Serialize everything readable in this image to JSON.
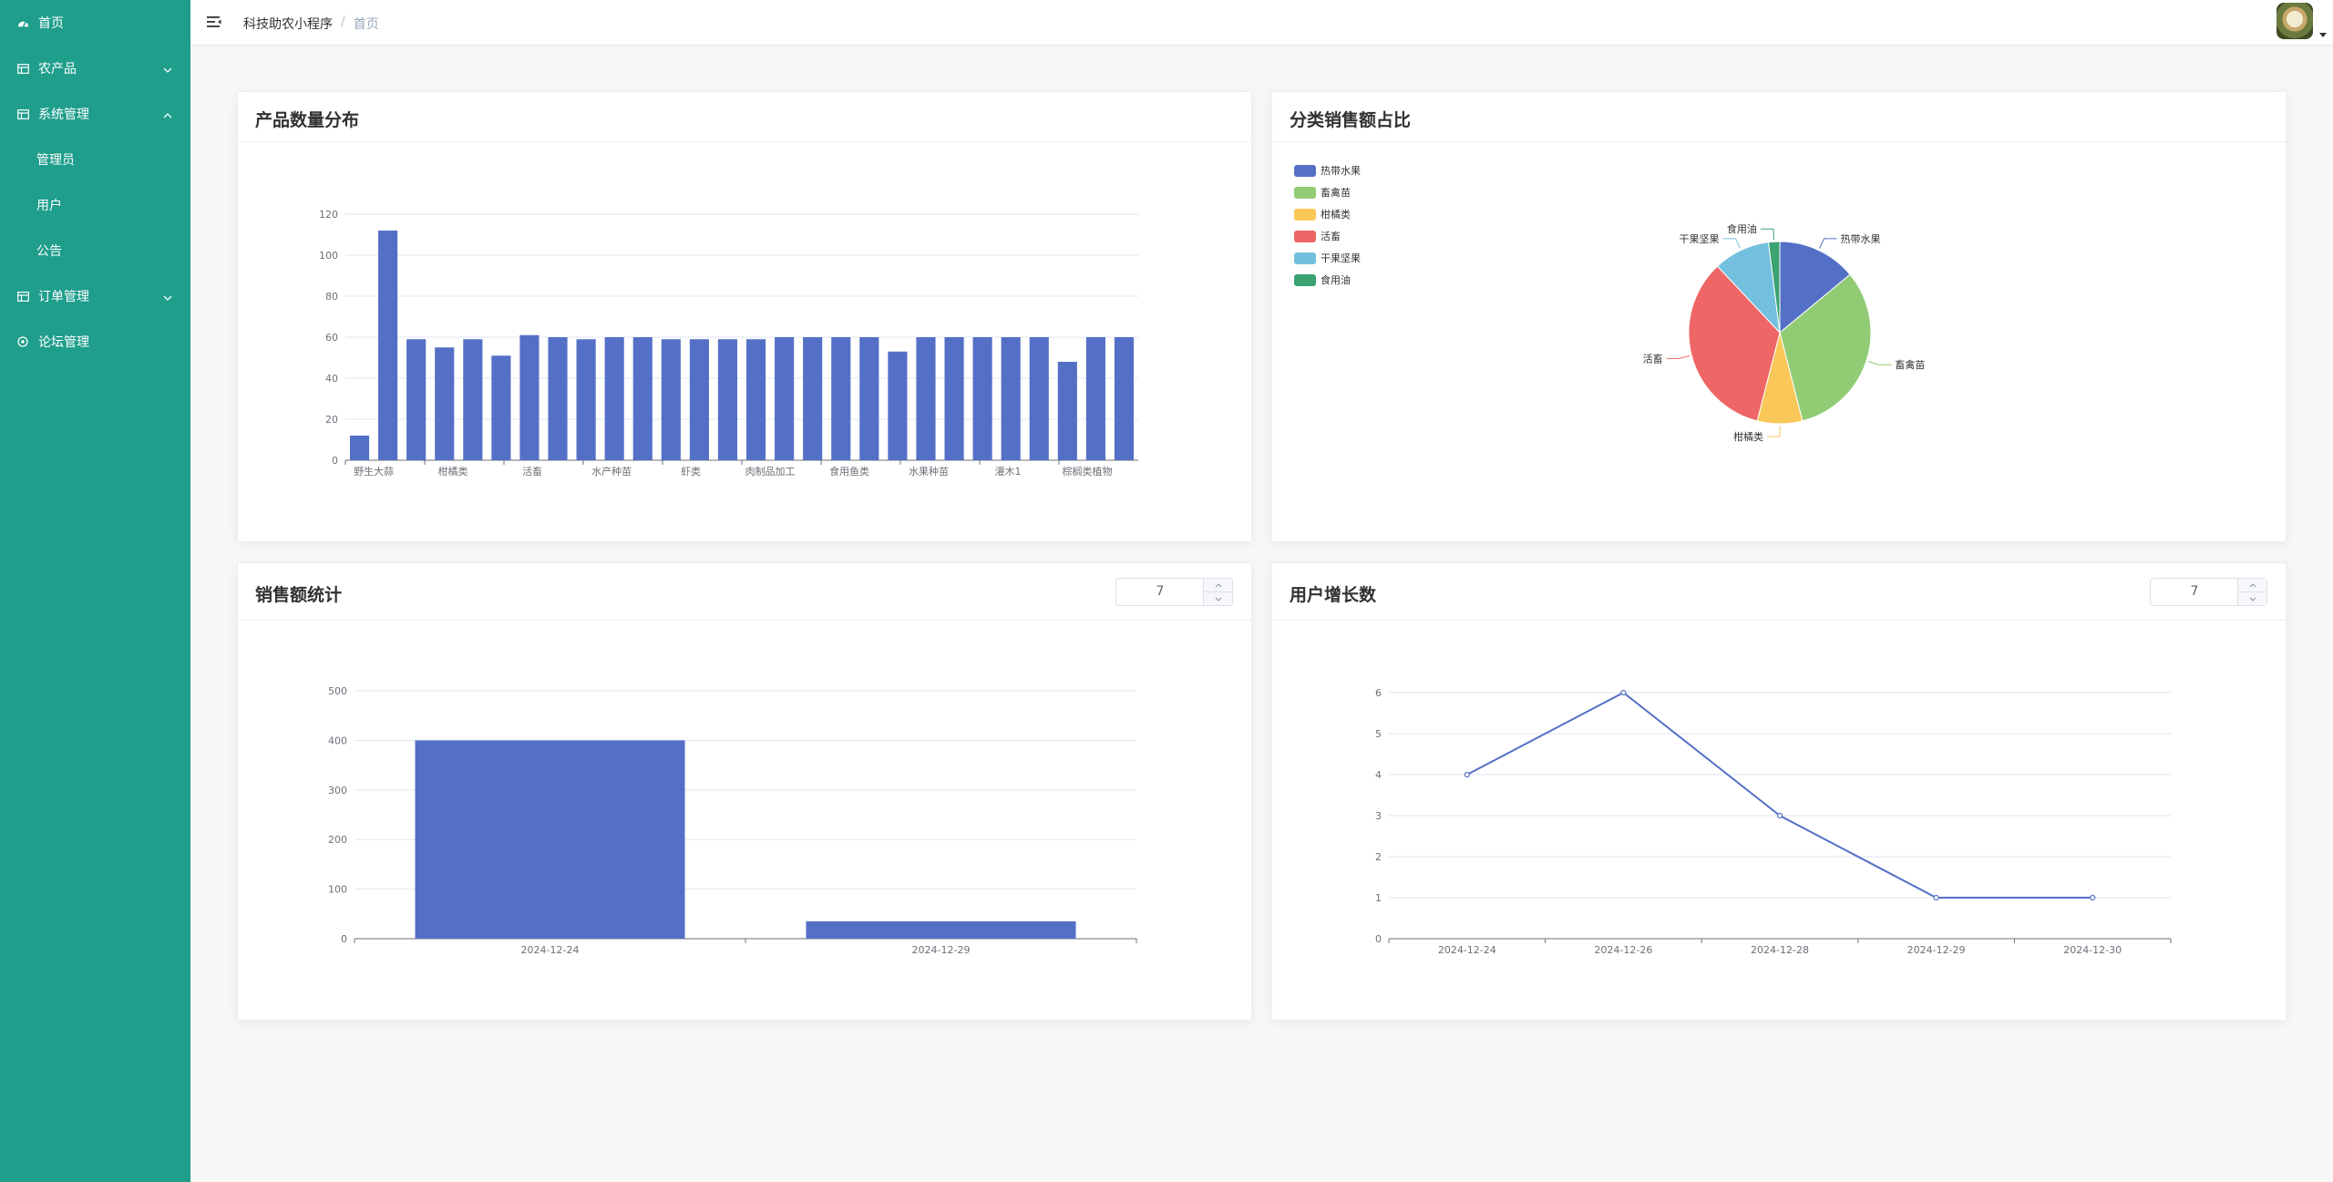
{
  "sidebar": {
    "items": [
      {
        "label": "首页",
        "icon": "dashboard-icon"
      },
      {
        "label": "农产品",
        "icon": "table-icon",
        "expanded": false
      },
      {
        "label": "系统管理",
        "icon": "table-icon",
        "expanded": true,
        "children": [
          {
            "label": "管理员"
          },
          {
            "label": "用户"
          },
          {
            "label": "公告"
          }
        ]
      },
      {
        "label": "订单管理",
        "icon": "table-icon",
        "expanded": false
      },
      {
        "label": "论坛管理",
        "icon": "forum-icon"
      }
    ],
    "bg_color": "#1f9e8c"
  },
  "header": {
    "breadcrumb": [
      "科技助农小程序",
      "首页"
    ]
  },
  "cards": {
    "product_count": {
      "title": "产品数量分布"
    },
    "category_sales": {
      "title": "分类销售额占比"
    },
    "sales_stats": {
      "title": "销售额统计",
      "days_value": "7"
    },
    "user_growth": {
      "title": "用户增长数",
      "days_value": "7"
    }
  },
  "chart_data": [
    {
      "type": "bar",
      "id": "product_count",
      "color": "#5470c6",
      "ylim": [
        0,
        120
      ],
      "yticks": [
        0,
        20,
        40,
        60,
        80,
        100,
        120
      ],
      "x_tick_labels": [
        "野生大蒜",
        "柑橘类",
        "活畜",
        "水产种苗",
        "虾类",
        "肉制品加工",
        "食用鱼类",
        "水果种苗",
        "灌木1",
        "棕榈类植物"
      ],
      "values": [
        12,
        112,
        59,
        55,
        59,
        51,
        61,
        60,
        59,
        60,
        60,
        59,
        59,
        59,
        59,
        60,
        60,
        60,
        60,
        53,
        60,
        60,
        60,
        60,
        60,
        48,
        60,
        60
      ]
    },
    {
      "type": "pie",
      "id": "category_sales",
      "slices": [
        {
          "name": "热带水果",
          "value": 14,
          "color": "#5470c6"
        },
        {
          "name": "畜禽苗",
          "value": 32,
          "color": "#91cc75"
        },
        {
          "name": "柑橘类",
          "value": 8,
          "color": "#fac858"
        },
        {
          "name": "活畜",
          "value": 34,
          "color": "#ee6666"
        },
        {
          "name": "干果坚果",
          "value": 10,
          "color": "#73c0de"
        },
        {
          "name": "食用油",
          "value": 2,
          "color": "#3ba272"
        }
      ]
    },
    {
      "type": "bar",
      "id": "sales_stats",
      "color": "#5470c6",
      "categories": [
        "2024-12-24",
        "2024-12-29"
      ],
      "values": [
        400,
        35
      ],
      "ylim": [
        0,
        500
      ],
      "yticks": [
        0,
        100,
        200,
        300,
        400,
        500
      ]
    },
    {
      "type": "line",
      "id": "user_growth",
      "color": "#5470c6",
      "x_tick_labels": [
        "2024-12-24",
        "2024-12-26",
        "2024-12-28",
        "2024-12-29",
        "2024-12-30"
      ],
      "values": [
        4,
        6,
        3,
        1,
        1
      ],
      "ylim": [
        0,
        6
      ],
      "yticks": [
        0,
        1,
        2,
        3,
        4,
        5,
        6
      ]
    }
  ]
}
